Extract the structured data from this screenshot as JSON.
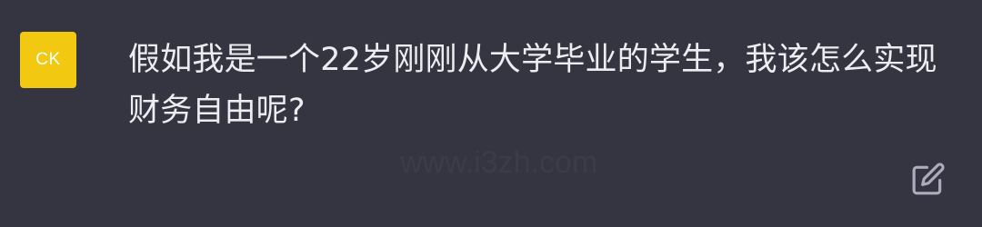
{
  "theme": {
    "background": "#343541",
    "text_color": "#ececf1",
    "avatar_color": "#f2c811",
    "icon_color": "#acacbe"
  },
  "message": {
    "avatar_initials": "CK",
    "text": "假如我是一个22岁刚刚从大学毕业的学生，我该怎么实现财务自由呢?"
  },
  "actions": {
    "edit_icon": "edit-icon"
  },
  "watermark": {
    "text": "www.i3zh.com"
  }
}
